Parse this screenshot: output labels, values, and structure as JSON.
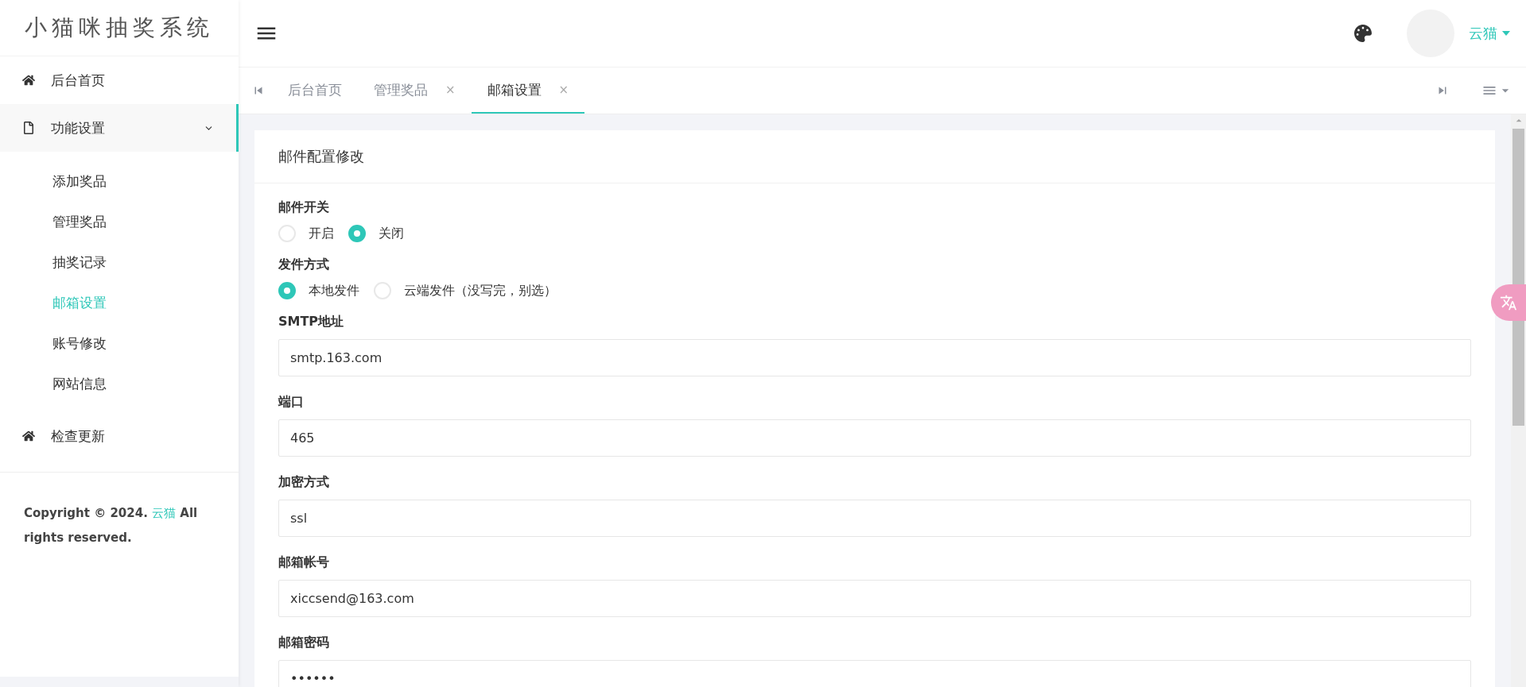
{
  "sidebar": {
    "logo": "小猫咪抽奖系统",
    "items": [
      {
        "label": "后台首页",
        "expanded": false
      },
      {
        "label": "功能设置",
        "expanded": true,
        "children": [
          {
            "label": "添加奖品",
            "selected": false
          },
          {
            "label": "管理奖品",
            "selected": false
          },
          {
            "label": "抽奖记录",
            "selected": false
          },
          {
            "label": "邮箱设置",
            "selected": true
          },
          {
            "label": "账号修改",
            "selected": false
          },
          {
            "label": "网站信息",
            "selected": false
          }
        ]
      },
      {
        "label": "检查更新",
        "expanded": false
      }
    ],
    "copyright": {
      "before": "Copyright © 2024.",
      "link": "云猫",
      "after": "All rights reserved."
    }
  },
  "header": {
    "user": "云猫"
  },
  "tabs": [
    {
      "label": "后台首页",
      "selected": false
    },
    {
      "label": "管理奖品",
      "close": "×",
      "selected": false
    },
    {
      "label": "邮箱设置",
      "close": "×",
      "selected": true
    }
  ],
  "card": {
    "title": "邮件配置修改",
    "fields": [
      {
        "kind": "radio",
        "label": "邮件开关",
        "options": [
          {
            "label": "开启",
            "selected": false
          },
          {
            "label": "关闭",
            "selected": true
          }
        ]
      },
      {
        "kind": "radio",
        "label": "发件方式",
        "options": [
          {
            "label": "本地发件",
            "selected": true
          },
          {
            "label": "云端发件（没写完，别选）",
            "selected": false
          }
        ]
      },
      {
        "kind": "input",
        "label": "SMTP地址",
        "value": "smtp.163.com"
      },
      {
        "kind": "input",
        "label": "端口",
        "value": "465"
      },
      {
        "kind": "input",
        "label": "加密方式",
        "value": "ssl"
      },
      {
        "kind": "input",
        "label": "邮箱帐号",
        "value": "xiccsend@163.com"
      },
      {
        "kind": "input",
        "label": "邮箱密码",
        "value": "••••••"
      }
    ]
  }
}
